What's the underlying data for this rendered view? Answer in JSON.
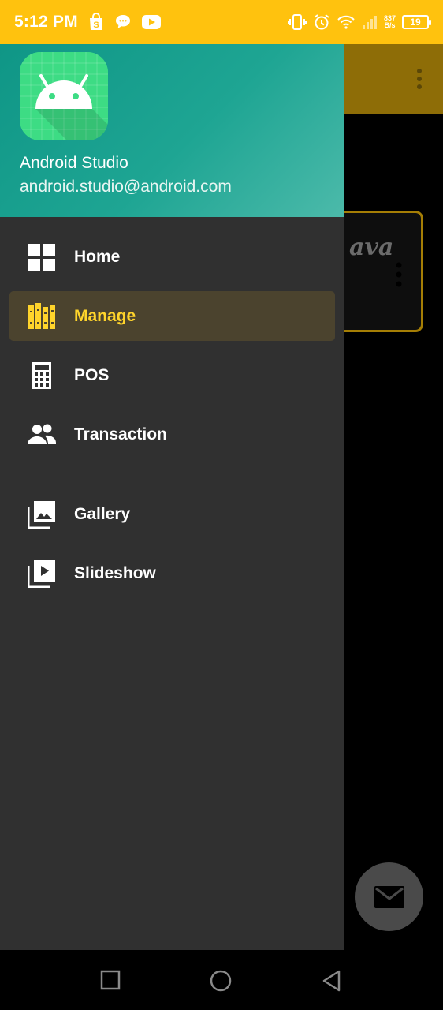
{
  "status_bar": {
    "time": "5:12 PM",
    "net_speed_value": "837",
    "net_speed_unit": "B/s",
    "battery": "19",
    "bg_color": "#FFC20E",
    "left_icons": [
      "shop-icon",
      "chat-icon",
      "youtube-icon"
    ],
    "right_icons": [
      "vibrate-icon",
      "alarm-icon",
      "wifi-icon",
      "signal-icon"
    ]
  },
  "drawer": {
    "header": {
      "name": "Android Studio",
      "email": "android.studio@android.com"
    },
    "items": [
      {
        "label": "Home",
        "icon": "dashboard-icon",
        "active": false
      },
      {
        "label": "Manage",
        "icon": "library-books-icon",
        "active": true
      },
      {
        "label": "POS",
        "icon": "calculator-icon",
        "active": false
      },
      {
        "label": "Transaction",
        "icon": "people-icon",
        "active": false
      },
      {
        "label": "Gallery",
        "icon": "photo-library-icon",
        "active": false
      },
      {
        "label": "Slideshow",
        "icon": "slideshow-icon",
        "active": false
      }
    ],
    "accent_color": "#FFD42B"
  },
  "background_app": {
    "card_text": "ava",
    "fab_icon": "mail-icon"
  },
  "nav_bar": {
    "buttons": [
      "recents-button",
      "home-button",
      "back-button"
    ]
  }
}
